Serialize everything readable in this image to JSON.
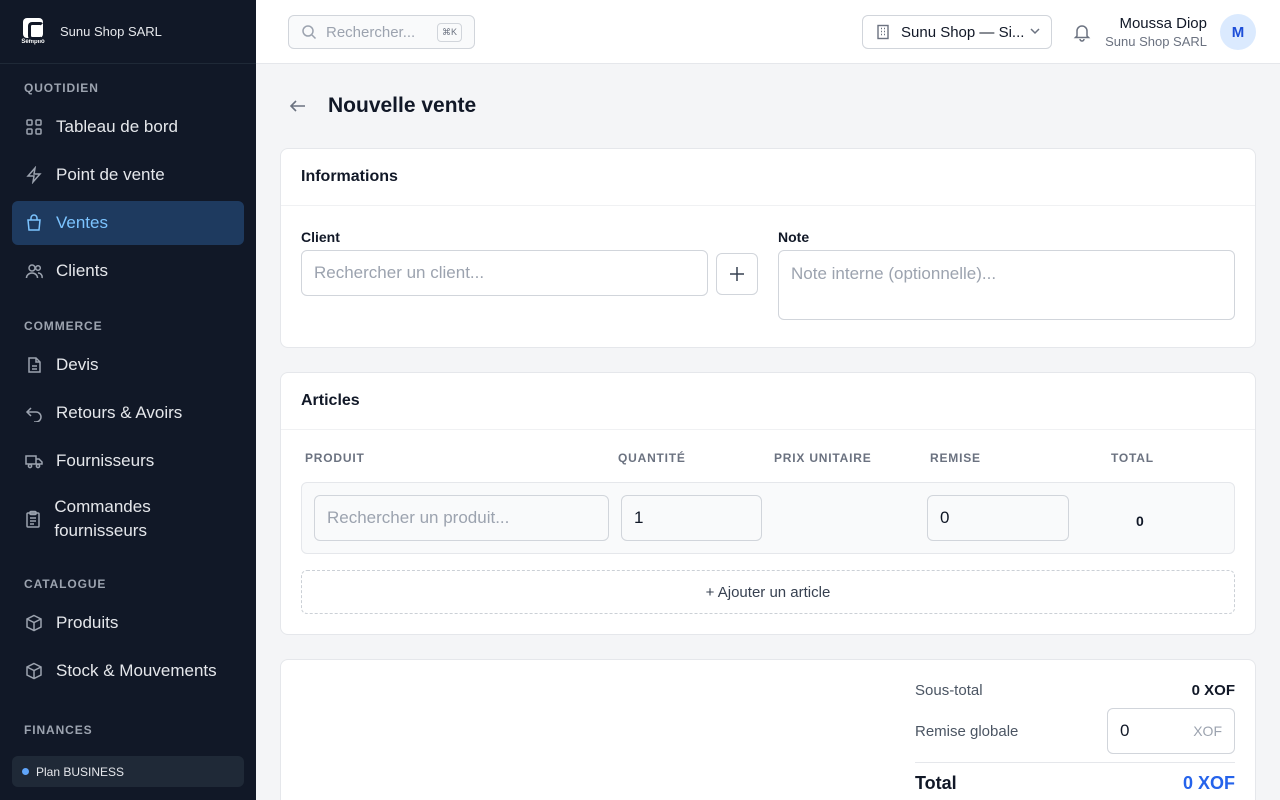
{
  "brand": {
    "logo_text": "Semplio",
    "company": "Sunu Shop SARL"
  },
  "sidebar": {
    "sections": [
      {
        "title": "QUOTIDIEN",
        "items": [
          {
            "label": "Tableau de bord",
            "icon": "grid-icon"
          },
          {
            "label": "Point de vente",
            "icon": "lightning-icon"
          },
          {
            "label": "Ventes",
            "icon": "shopping-bag-icon",
            "active": true
          },
          {
            "label": "Clients",
            "icon": "users-icon"
          }
        ]
      },
      {
        "title": "COMMERCE",
        "items": [
          {
            "label": "Devis",
            "icon": "document-icon"
          },
          {
            "label": "Retours & Avoirs",
            "icon": "undo-icon"
          },
          {
            "label": "Fournisseurs",
            "icon": "truck-icon"
          },
          {
            "label": "Commandes fournisseurs",
            "icon": "clipboard-icon"
          }
        ]
      },
      {
        "title": "CATALOGUE",
        "items": [
          {
            "label": "Produits",
            "icon": "box-icon"
          },
          {
            "label": "Stock & Mouvements",
            "icon": "cube-icon"
          }
        ]
      },
      {
        "title": "FINANCES",
        "items": []
      }
    ],
    "plan": "Plan BUSINESS"
  },
  "header": {
    "search_placeholder": "Rechercher...",
    "search_shortcut": "⌘K",
    "shop_select": "Sunu Shop — Si...",
    "user_name": "Moussa Diop",
    "user_org": "Sunu Shop SARL",
    "avatar_initial": "M"
  },
  "page": {
    "title": "Nouvelle vente",
    "informations": {
      "title": "Informations",
      "client_label": "Client",
      "client_placeholder": "Rechercher un client...",
      "note_label": "Note",
      "note_placeholder": "Note interne (optionnelle)..."
    },
    "articles": {
      "title": "Articles",
      "columns": [
        "PRODUIT",
        "QUANTITÉ",
        "PRIX UNITAIRE",
        "REMISE",
        "TOTAL"
      ],
      "row": {
        "product_placeholder": "Rechercher un produit...",
        "quantity": "1",
        "remise": "0",
        "total": "0"
      },
      "add_label": "+ Ajouter un article"
    },
    "summary": {
      "subtotal_label": "Sous-total",
      "subtotal_value": "0 XOF",
      "remise_label": "Remise globale",
      "remise_value": "0",
      "remise_currency": "XOF",
      "total_label": "Total",
      "total_value": "0 XOF"
    }
  },
  "colors": {
    "sidebar_bg": "#111827",
    "accent": "#2563eb",
    "active_item": "#7cc4ff"
  }
}
